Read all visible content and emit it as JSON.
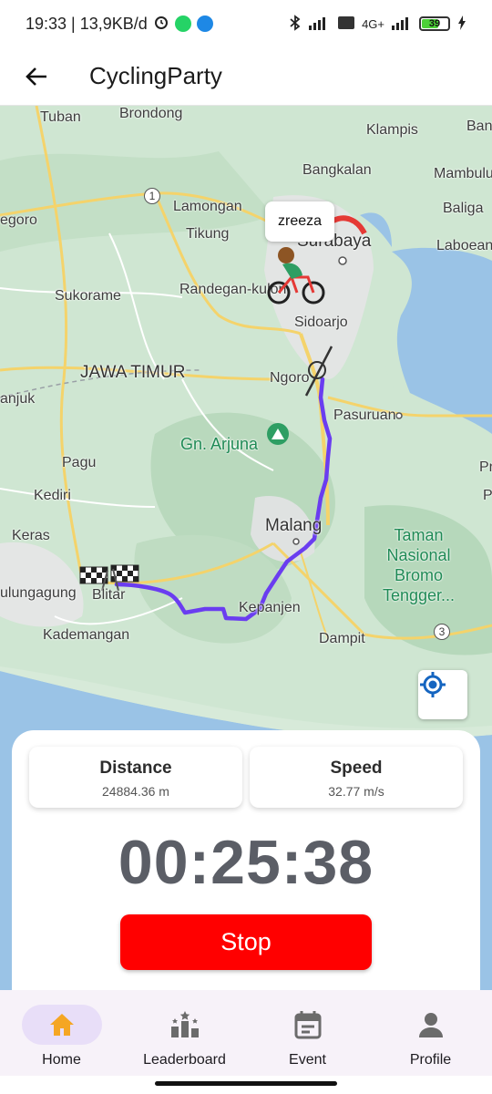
{
  "status_bar": {
    "time_info": "19:33 | 13,9KB/d",
    "network": "4G+",
    "battery": "39"
  },
  "app_bar": {
    "title": "CyclingParty"
  },
  "map": {
    "labels": {
      "tuban": "Tuban",
      "brondong": "Brondong",
      "klampis": "Klampis",
      "ban": "Ban",
      "bangkalan": "Bangkalan",
      "mambulu": "Mambulu",
      "lamongan": "Lamongan",
      "baliga": "Baliga",
      "egoro": "egoro",
      "surabaya": "Surabaya",
      "laboean": "Laboean",
      "tikung": "Tikung",
      "sukorame": "Sukorame",
      "randegan": "Randegan-kulon",
      "sidoarjo": "Sidoarjo",
      "jawa_timur": "JAWA TIMUR",
      "ngoro": "Ngoro",
      "anjuk": "anjuk",
      "pasuruan": "Pasuruan",
      "arjuna": "Gn. Arjuna",
      "pagu": "Pagu",
      "pr": "Pr",
      "kediri": "Kediri",
      "p": "P",
      "malang": "Malang",
      "keras": "Keras",
      "taman": "Taman\nNasional\nBromo\nTengger...",
      "tulungagung": "ulungagung",
      "blitar": "Blitar",
      "kepanjen": "Kepanjen",
      "kademangan": "Kademangan",
      "dampit": "Dampit",
      "road_1": "1",
      "road_3": "3"
    },
    "rider_name": "zreeza",
    "route_color": "#6a3df0"
  },
  "stats": {
    "distance_label": "Distance",
    "distance_value": "24884.36 m",
    "speed_label": "Speed",
    "speed_value": "32.77 m/s",
    "timer": "00:25:38",
    "stop_label": "Stop"
  },
  "nav": {
    "items": [
      {
        "label": "Home",
        "icon": "home-icon"
      },
      {
        "label": "Leaderboard",
        "icon": "leaderboard-icon"
      },
      {
        "label": "Event",
        "icon": "event-icon"
      },
      {
        "label": "Profile",
        "icon": "profile-icon"
      }
    ]
  }
}
